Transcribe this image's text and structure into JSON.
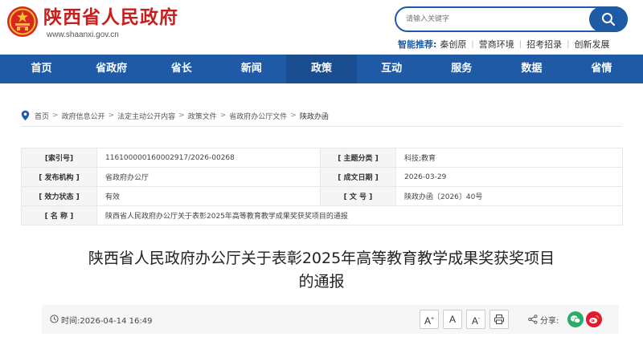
{
  "header": {
    "site_title": "陕西省人民政府",
    "site_url": "www.shaanxi.gov.cn",
    "search_placeholder": "请输入关键字",
    "quick_label": "智能推荐:",
    "quick_links": [
      "秦创原",
      "营商环境",
      "招考招录",
      "创新发展"
    ]
  },
  "nav": {
    "items": [
      "首页",
      "省政府",
      "省长",
      "新闻",
      "政策",
      "互动",
      "服务",
      "数据",
      "省情"
    ],
    "active_index": 4
  },
  "breadcrumb": [
    "首页",
    "政府信息公开",
    "法定主动公开内容",
    "政策文件",
    "省政府办公厅文件",
    "陕政办函"
  ],
  "info": {
    "index_label": "[索引号]",
    "index_value": "116100000160002917/2026-00268",
    "topic_label": "[ 主题分类 ]",
    "topic_value": "科技;教育",
    "issuer_label": "[ 发布机构 ]",
    "issuer_value": "省政府办公厅",
    "date_label": "[ 成文日期 ]",
    "date_value": "2026-03-29",
    "status_label": "[ 效力状态 ]",
    "status_value": "有效",
    "docno_label": "[ 文 号 ]",
    "docno_value": "陕政办函〔2026〕40号",
    "name_label": "[ 名 称 ]",
    "name_value": "陕西省人民政府办公厅关于表彰2025年高等教育教学成果奖获奖项目的通报"
  },
  "document": {
    "title_line1": "陕西省人民政府办公厅关于表彰2025年高等教育教学成果奖获奖项目",
    "title_line2": "的通报"
  },
  "toolbar": {
    "time_label": "时间:",
    "time_value": "2026-04-14 16:49",
    "font_larger": "A",
    "font_larger_sup": "+",
    "font_normal": "A",
    "font_smaller": "A",
    "font_smaller_sup": "-",
    "share_label": "分享:"
  },
  "colors": {
    "brand_red": "#c81e1e",
    "nav_blue": "#1f5aa6",
    "wechat_green": "#2aae67",
    "weibo_red": "#e6162d"
  }
}
